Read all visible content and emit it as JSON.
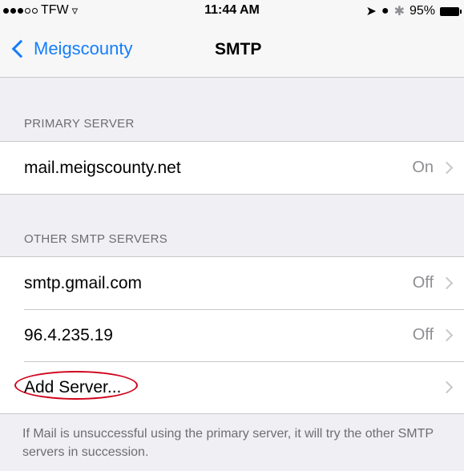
{
  "status_bar": {
    "carrier": "TFW",
    "time": "11:44 AM",
    "battery": "95%"
  },
  "nav": {
    "back_label": "Meigscounty",
    "title": "SMTP"
  },
  "primary_section": {
    "header": "PRIMARY SERVER",
    "rows": [
      {
        "label": "mail.meigscounty.net",
        "value": "On"
      }
    ]
  },
  "other_section": {
    "header": "OTHER SMTP SERVERS",
    "rows": [
      {
        "label": "smtp.gmail.com",
        "value": "Off"
      },
      {
        "label": "96.4.235.19",
        "value": "Off"
      },
      {
        "label": "Add Server...",
        "value": ""
      }
    ]
  },
  "footer_note": "If Mail is unsuccessful using the primary server, it will try the other SMTP servers in succession.",
  "colors": {
    "accent": "#147efb",
    "annotation": "#d0021b"
  }
}
